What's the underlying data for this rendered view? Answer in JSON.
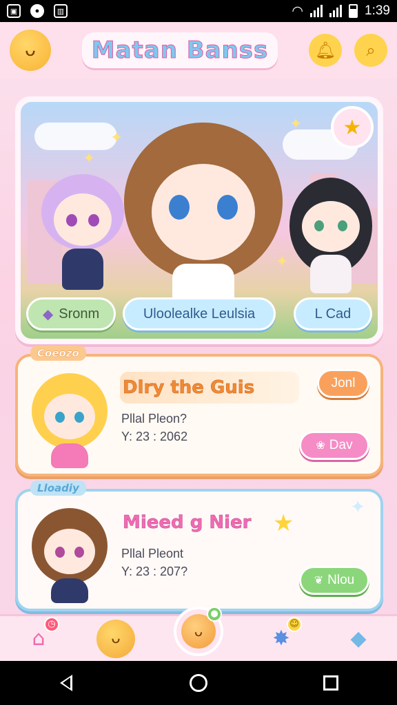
{
  "status_bar": {
    "time": "1:39",
    "icons": [
      "image-icon",
      "chat-icon",
      "sim-icon",
      "wifi-icon",
      "signal-icon",
      "battery-icon"
    ]
  },
  "header": {
    "title": "Matan Banss",
    "left_icon": "cat-mascot-icon",
    "right_icons": [
      "bell-icon",
      "search-icon"
    ]
  },
  "hero": {
    "buttons": [
      {
        "label": "Sronm",
        "icon": "gem-icon"
      },
      {
        "label": "Uloolealke Leulsia"
      },
      {
        "label": "L Cad"
      }
    ],
    "badge_icon": "star-icon"
  },
  "events": [
    {
      "tag": "Coeozo",
      "title": "Dlry the Guis",
      "subtitle": "Pllal Pleon?",
      "date": "Y: 23 : 2062",
      "top_button": "Jonl",
      "action_label": "Dav",
      "action_icon": "calendar-icon"
    },
    {
      "tag": "Lloadiy",
      "title": "Mieed g Nier",
      "subtitle": "Pllal Pleont",
      "date": "Y: 23 : 207?",
      "action_label": "Nlou",
      "action_icon": "leaf-icon"
    }
  ],
  "bottom_nav": {
    "items": [
      "home-icon",
      "cat-icon",
      "pet-icon",
      "blob-icon",
      "bird-icon"
    ]
  },
  "colors": {
    "background": "#fbd3e4",
    "accent_pink": "#f06bb3",
    "accent_orange": "#f9a15c",
    "accent_blue": "#9fd3f0",
    "accent_green": "#8bd67a"
  }
}
